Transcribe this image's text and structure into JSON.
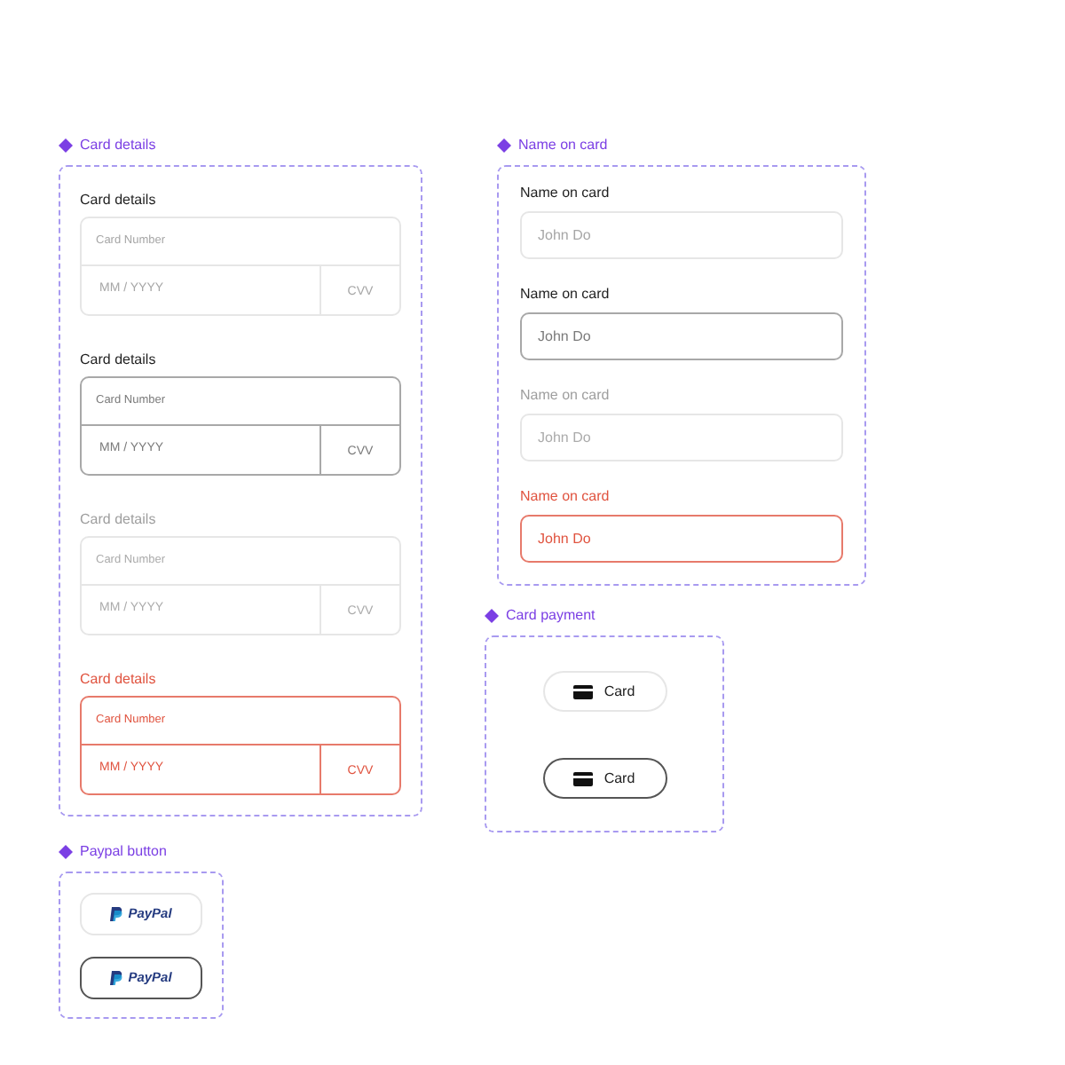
{
  "card_details": {
    "title": "Card details",
    "variants": [
      {
        "kind": "default",
        "label": "Card details",
        "number_placeholder": "Card Number",
        "expiry_placeholder": "MM / YYYY",
        "cvv_placeholder": "CVV"
      },
      {
        "kind": "hover",
        "label": "Card details",
        "number_placeholder": "Card Number",
        "expiry_placeholder": "MM / YYYY",
        "cvv_placeholder": "CVV"
      },
      {
        "kind": "disabled",
        "label": "Card details",
        "number_placeholder": "Card Number",
        "expiry_placeholder": "MM / YYYY",
        "cvv_placeholder": "CVV"
      },
      {
        "kind": "error",
        "label": "Card details",
        "number_placeholder": "Card Number",
        "expiry_placeholder": "MM / YYYY",
        "cvv_placeholder": "CVV"
      }
    ]
  },
  "name_on_card": {
    "title": "Name on card",
    "variants": [
      {
        "kind": "default",
        "label": "Name on card",
        "placeholder": "John Do"
      },
      {
        "kind": "hover",
        "label": "Name on card",
        "placeholder": "John Do"
      },
      {
        "kind": "disabled",
        "label": "Name on card",
        "placeholder": "John Do"
      },
      {
        "kind": "error",
        "label": "Name on card",
        "placeholder": "John Do"
      }
    ]
  },
  "card_payment": {
    "title": "Card payment",
    "buttons": [
      {
        "kind": "default",
        "label": "Card"
      },
      {
        "kind": "hover",
        "label": "Card"
      }
    ]
  },
  "paypal_button": {
    "title": "Paypal button",
    "buttons": [
      {
        "kind": "default",
        "logo": "PayPal"
      },
      {
        "kind": "hover",
        "logo": "PayPal"
      }
    ]
  }
}
